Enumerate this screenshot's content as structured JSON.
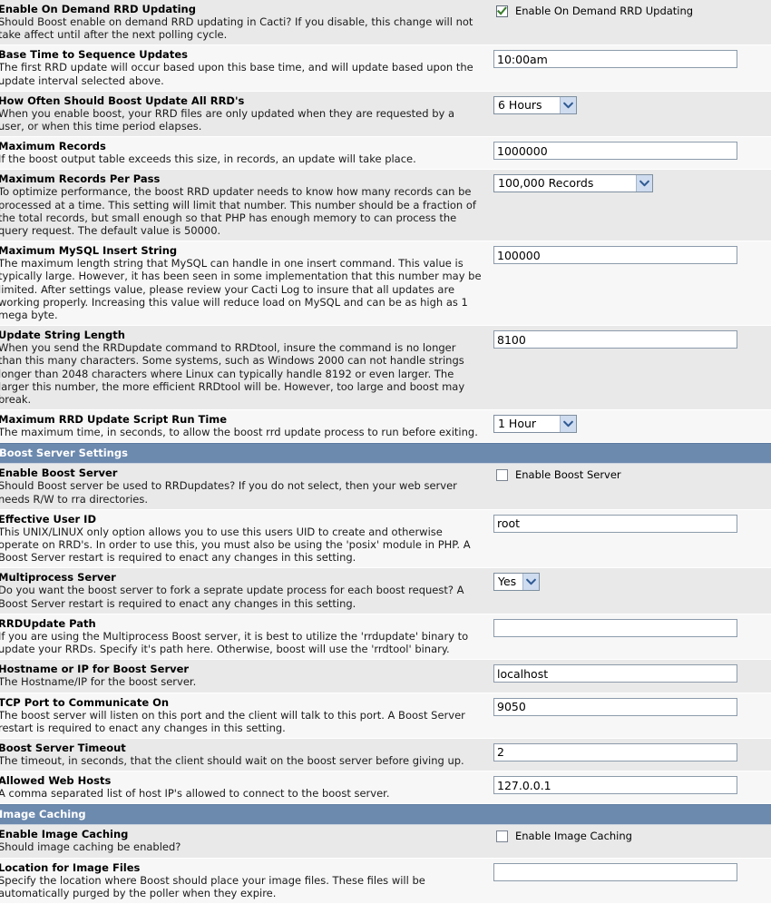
{
  "page": {
    "title": "Cacti Boost Settings"
  },
  "icons": {
    "checkmark": "check-icon",
    "dropdown_arrow": "chevron-down-icon"
  },
  "colors": {
    "section_header_bg": "#6c89ae",
    "section_header_text": "#ffffff",
    "row_odd_bg": "#e9e9e9",
    "row_even_bg": "#f7f7f7",
    "checkmark": "#3a7d2c",
    "dropdown_arrow": "#2f5a93",
    "input_border": "#8c9bab"
  },
  "rows": [
    {
      "name": "Enable On Demand RRD Updating",
      "desc": "Should Boost enable on demand RRD updating in Cacti? If you disable, this change will not take affect until after the next polling cycle.",
      "control": "checkbox",
      "checked": true,
      "control_label": "Enable On Demand RRD Updating"
    },
    {
      "name": "Base Time to Sequence Updates",
      "desc": "The first RRD update will occur based upon this base time, and will update based upon the update interval selected above.",
      "control": "text",
      "value": "10:00am"
    },
    {
      "name": "How Often Should Boost Update All RRD's",
      "desc": "When you enable boost, your RRD files are only updated when they are requested by a user, or when this time period elapses.",
      "control": "select",
      "value": "6 Hours"
    },
    {
      "name": "Maximum Records",
      "desc": "If the boost output table exceeds this size, in records, an update will take place.",
      "control": "text",
      "value": "1000000"
    },
    {
      "name": "Maximum Records Per Pass",
      "desc": "To optimize performance, the boost RRD updater needs to know how many records can be processed at a time. This setting will limit that number. This number should be a fraction of the total records, but small enough so that PHP has enough memory to can process the query request. The default value is 50000.",
      "control": "select",
      "value": "100,000 Records"
    },
    {
      "name": "Maximum MySQL Insert String",
      "desc": "The maximum length string that MySQL can handle in one insert command. This value is typically large. However, it has been seen in some implementation that this number may be limited. After settings value, please review your Cacti Log to insure that all updates are working properly. Increasing this value will reduce load on MySQL and can be as high as 1 mega byte.",
      "control": "text",
      "value": "100000"
    },
    {
      "name": "Update String Length",
      "desc": "When you send the RRDupdate command to RRDtool, insure the command is no longer than this many characters. Some systems, such as Windows 2000 can not handle strings longer than 2048 characters where Linux can typically handle 8192 or even larger. The larger this number, the more efficient RRDtool will be. However, too large and boost may break.",
      "control": "text",
      "value": "8100"
    },
    {
      "name": "Maximum RRD Update Script Run Time",
      "desc": "The maximum time, in seconds, to allow the boost rrd update process to run before exiting.",
      "control": "select",
      "value": "1 Hour"
    }
  ],
  "section_boost_server": {
    "title": "Boost Server Settings",
    "rows": [
      {
        "name": "Enable Boost Server",
        "desc": "Should Boost server be used to RRDupdates? If you do not select, then your web server needs R/W to rra directories.",
        "control": "checkbox",
        "checked": false,
        "control_label": "Enable Boost Server"
      },
      {
        "name": "Effective User ID",
        "desc": "This UNIX/LINUX only option allows you to use this users UID to create and otherwise operate on RRD's. In order to use this, you must also be using the 'posix' module in PHP. A Boost Server restart is required to enact any changes in this setting.",
        "control": "text",
        "value": "root"
      },
      {
        "name": "Multiprocess Server",
        "desc": "Do you want the boost server to fork a seprate update process for each boost request? A Boost Server restart is required to enact any changes in this setting.",
        "control": "select",
        "value": "Yes"
      },
      {
        "name": "RRDUpdate Path",
        "desc": "If you are using the Multiprocess Boost server, it is best to utilize the 'rrdupdate' binary to update your RRDs. Specify it's path here. Otherwise, boost will use the 'rrdtool' binary.",
        "control": "text",
        "value": ""
      },
      {
        "name": "Hostname or IP for Boost Server",
        "desc": "The Hostname/IP for the boost server.",
        "control": "text",
        "value": "localhost"
      },
      {
        "name": "TCP Port to Communicate On",
        "desc": "The boost server will listen on this port and the client will talk to this port. A Boost Server restart is required to enact any changes in this setting.",
        "control": "text",
        "value": "9050"
      },
      {
        "name": "Boost Server Timeout",
        "desc": "The timeout, in seconds, that the client should wait on the boost server before giving up.",
        "control": "text",
        "value": "2"
      },
      {
        "name": "Allowed Web Hosts",
        "desc": "A comma separated list of host IP's allowed to connect to the boost server.",
        "control": "text",
        "value": "127.0.0.1"
      }
    ]
  },
  "section_image_caching": {
    "title": "Image Caching",
    "rows": [
      {
        "name": "Enable Image Caching",
        "desc": "Should image caching be enabled?",
        "control": "checkbox",
        "checked": false,
        "control_label": "Enable Image Caching"
      },
      {
        "name": "Location for Image Files",
        "desc": "Specify the location where Boost should place your image files. These files will be automatically purged by the poller when they expire.",
        "control": "text",
        "value": ""
      }
    ]
  }
}
